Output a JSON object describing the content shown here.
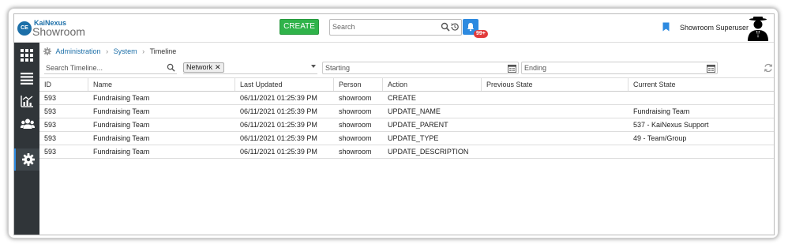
{
  "brand": {
    "name": "KaiNexus",
    "product": "Showroom",
    "mark": "CE"
  },
  "header": {
    "create_label": "CREATE",
    "search_placeholder": "Search",
    "notification_count": "99+",
    "user_name": "Showroom Superuser"
  },
  "sidebar": {
    "items": [
      {
        "icon": "apps-grid-icon",
        "active": false
      },
      {
        "icon": "list-icon",
        "active": false
      },
      {
        "icon": "chart-icon",
        "active": false
      },
      {
        "icon": "people-icon",
        "active": false
      },
      {
        "icon": "gear-icon",
        "active": true
      }
    ]
  },
  "breadcrumb": {
    "items": [
      {
        "label": "Administration"
      },
      {
        "label": "System"
      },
      {
        "label": "Timeline"
      }
    ]
  },
  "filters": {
    "search_placeholder": "Search Timeline...",
    "tag": "Network",
    "start_placeholder": "Starting",
    "end_placeholder": "Ending"
  },
  "table": {
    "columns": [
      "ID",
      "Name",
      "Last Updated",
      "Person",
      "Action",
      "Previous State",
      "Current State"
    ],
    "rows": [
      [
        "593",
        "Fundraising Team",
        "06/11/2021 01:25:39 PM",
        "showroom",
        "CREATE",
        "",
        ""
      ],
      [
        "593",
        "Fundraising Team",
        "06/11/2021 01:25:39 PM",
        "showroom",
        "UPDATE_NAME",
        "",
        "Fundraising Team"
      ],
      [
        "593",
        "Fundraising Team",
        "06/11/2021 01:25:39 PM",
        "showroom",
        "UPDATE_PARENT",
        "",
        "537 - KaiNexus Support"
      ],
      [
        "593",
        "Fundraising Team",
        "06/11/2021 01:25:39 PM",
        "showroom",
        "UPDATE_TYPE",
        "",
        "49 - Team/Group"
      ],
      [
        "593",
        "Fundraising Team",
        "06/11/2021 01:25:39 PM",
        "showroom",
        "UPDATE_DESCRIPTION",
        "",
        ""
      ]
    ]
  },
  "colors": {
    "accent": "#2d8ae0",
    "create": "#2fb34a",
    "sidebar": "#303539",
    "badge": "#e23b3b",
    "link": "#1c6fa8"
  }
}
